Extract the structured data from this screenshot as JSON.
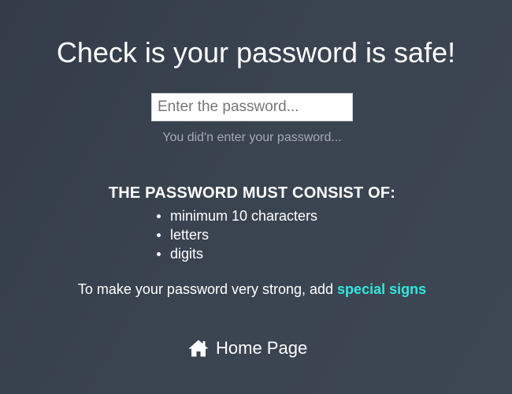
{
  "header": {
    "title": "Check is your password is safe!"
  },
  "password_input": {
    "value": "",
    "placeholder": "Enter the password..."
  },
  "status": {
    "message": "You did'n enter your password..."
  },
  "rules": {
    "heading": "THE PASSWORD MUST CONSIST OF:",
    "items": [
      "minimum 10 characters",
      "letters",
      "digits"
    ]
  },
  "tip": {
    "text": "To make your password very strong, add ",
    "link_label": "special signs"
  },
  "nav": {
    "home_label": "Home Page",
    "home_icon": "home-icon"
  },
  "colors": {
    "background": "#3a4350",
    "accent": "#2ee8e0",
    "status_text": "#a4aab2"
  }
}
